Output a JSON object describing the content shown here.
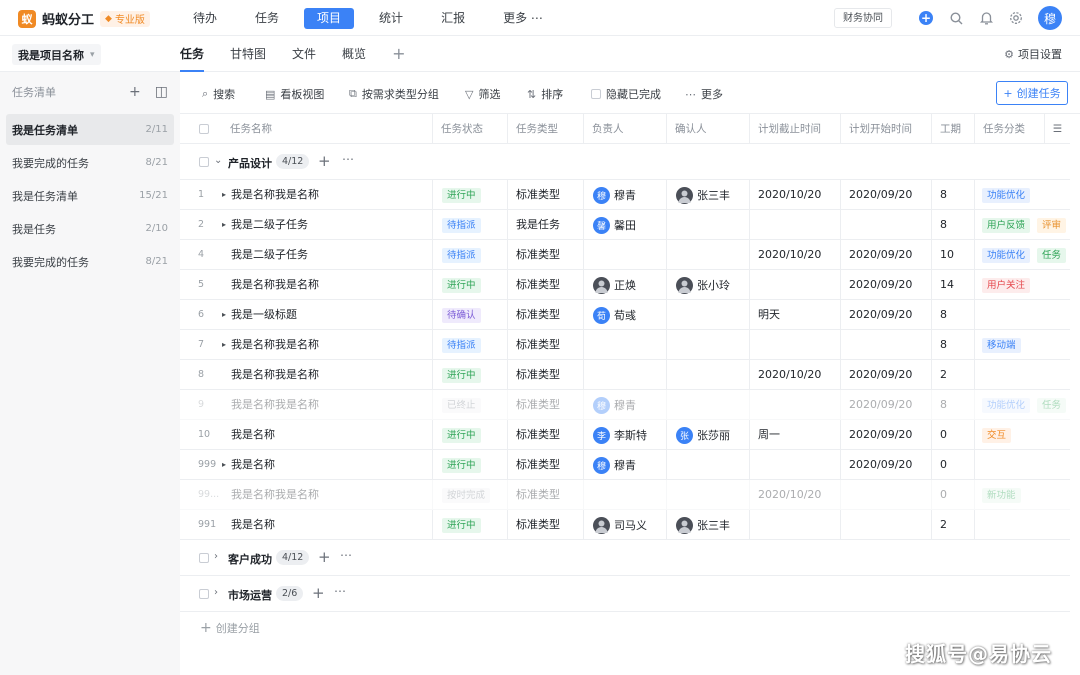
{
  "app": {
    "name": "蚂蚁分工",
    "logo_glyph": "蚁",
    "pro_badge": "专业版",
    "nav": [
      "待办",
      "任务",
      "项目",
      "统计",
      "汇报",
      "更多"
    ],
    "nav_more_glyph": "⋯",
    "active_nav": "项目",
    "finance_label": "财务协同",
    "user_avatar": "穆",
    "accent_color": "#3b82f6"
  },
  "project": {
    "name": "我是项目名称",
    "tabs": [
      "任务",
      "甘特图",
      "文件",
      "概览"
    ],
    "active_tab": "任务",
    "settings_label": "项目设置"
  },
  "sidebar": {
    "header": "任务清单",
    "items": [
      {
        "label": "我是任务清单",
        "count": "2/11"
      },
      {
        "label": "我要完成的任务",
        "count": "8/21"
      },
      {
        "label": "我是任务清单",
        "count": "15/21"
      },
      {
        "label": "我是任务",
        "count": "2/10"
      },
      {
        "label": "我要完成的任务",
        "count": "8/21"
      }
    ]
  },
  "toolbar": {
    "search": "搜索",
    "kanban": "看板视图",
    "group_by": "按需求类型分组",
    "filter": "筛选",
    "sort": "排序",
    "hide_done": "隐藏已完成",
    "more": "更多",
    "create": "创建任务"
  },
  "table": {
    "columns": [
      "任务名称",
      "任务状态",
      "任务类型",
      "负责人",
      "确认人",
      "计划截止时间",
      "计划开始时间",
      "工期",
      "任务分类"
    ],
    "groups": [
      {
        "name": "产品设计",
        "count": "4/12",
        "expanded": true
      },
      {
        "name": "客户成功",
        "count": "4/12",
        "expanded": false
      },
      {
        "name": "市场运营",
        "count": "2/6",
        "expanded": false
      }
    ],
    "rows": [
      {
        "num": "1",
        "caret": "▸",
        "name": "我是名称我是名称",
        "status": "进行中",
        "type": "标准类型",
        "owner": "穆青",
        "owner_av": "穆",
        "owner_photo": false,
        "confirmer": "张三丰",
        "confirmer_av": "",
        "confirmer_photo": true,
        "deadline": "2020/10/20",
        "start": "2020/09/20",
        "duration": "8",
        "tags": [
          "功能优化"
        ],
        "dim": false
      },
      {
        "num": "2",
        "caret": "▸",
        "name": "我是二级子任务",
        "status": "待指派",
        "type": "我是任务",
        "owner": "馨田",
        "owner_av": "馨",
        "owner_photo": false,
        "confirmer": "",
        "confirmer_av": "",
        "confirmer_photo": false,
        "deadline": "",
        "start": "",
        "duration": "8",
        "tags": [
          "用户反馈",
          "评审"
        ],
        "dim": false
      },
      {
        "num": "4",
        "caret": "",
        "name": "我是二级子任务",
        "status": "待指派",
        "type": "标准类型",
        "owner": "",
        "owner_av": "",
        "owner_photo": false,
        "confirmer": "",
        "confirmer_av": "",
        "confirmer_photo": false,
        "deadline": "2020/10/20",
        "start": "2020/09/20",
        "duration": "10",
        "tags": [
          "功能优化",
          "任务"
        ],
        "dim": false
      },
      {
        "num": "5",
        "caret": "",
        "name": "我是名称我是名称",
        "status": "进行中",
        "type": "标准类型",
        "owner": "正焕",
        "owner_av": "",
        "owner_photo": true,
        "confirmer": "张小玲",
        "confirmer_av": "",
        "confirmer_photo": true,
        "deadline": "",
        "start": "2020/09/20",
        "duration": "14",
        "tags": [
          "用户关注"
        ],
        "dim": false
      },
      {
        "num": "6",
        "caret": "▸",
        "name": "我是一级标题",
        "status": "待确认",
        "type": "标准类型",
        "owner": "荀彧",
        "owner_av": "荀",
        "owner_photo": false,
        "confirmer": "",
        "confirmer_av": "",
        "confirmer_photo": false,
        "deadline": "明天",
        "start": "2020/09/20",
        "duration": "8",
        "tags": [],
        "dim": false
      },
      {
        "num": "7",
        "caret": "▸",
        "name": "我是名称我是名称",
        "status": "待指派",
        "type": "标准类型",
        "owner": "",
        "owner_av": "",
        "owner_photo": false,
        "confirmer": "",
        "confirmer_av": "",
        "confirmer_photo": false,
        "deadline": "",
        "start": "",
        "duration": "8",
        "tags": [
          "移动端"
        ],
        "dim": false
      },
      {
        "num": "8",
        "caret": "",
        "name": "我是名称我是名称",
        "status": "进行中",
        "type": "标准类型",
        "owner": "",
        "owner_av": "",
        "owner_photo": false,
        "confirmer": "",
        "confirmer_av": "",
        "confirmer_photo": false,
        "deadline": "2020/10/20",
        "start": "2020/09/20",
        "duration": "2",
        "tags": [],
        "dim": false
      },
      {
        "num": "9",
        "caret": "",
        "name": "我是名称我是名称",
        "status": "已终止",
        "type": "标准类型",
        "owner": "穆青",
        "owner_av": "穆",
        "owner_photo": false,
        "confirmer": "",
        "confirmer_av": "",
        "confirmer_photo": false,
        "deadline": "",
        "start": "2020/09/20",
        "duration": "8",
        "tags": [
          "功能优化",
          "任务"
        ],
        "dim": true
      },
      {
        "num": "10",
        "caret": "",
        "name": "我是名称",
        "status": "进行中",
        "type": "标准类型",
        "owner": "李斯特",
        "owner_av": "李",
        "owner_photo": false,
        "confirmer": "张莎丽",
        "confirmer_av": "张",
        "confirmer_photo": false,
        "deadline": "周一",
        "start": "2020/09/20",
        "duration": "0",
        "tags": [
          "交互"
        ],
        "dim": false
      },
      {
        "num": "999",
        "caret": "▸",
        "name": "我是名称",
        "status": "进行中",
        "type": "标准类型",
        "owner": "穆青",
        "owner_av": "穆",
        "owner_photo": false,
        "confirmer": "",
        "confirmer_av": "",
        "confirmer_photo": false,
        "deadline": "",
        "start": "2020/09/20",
        "duration": "0",
        "tags": [],
        "dim": false
      },
      {
        "num": "99...",
        "caret": "",
        "name": "我是名称我是名称",
        "status": "按时完成",
        "type": "标准类型",
        "owner": "",
        "owner_av": "",
        "owner_photo": false,
        "confirmer": "",
        "confirmer_av": "",
        "confirmer_photo": false,
        "deadline": "2020/10/20",
        "start": "",
        "duration": "0",
        "tags": [
          "新功能"
        ],
        "dim": true
      },
      {
        "num": "991",
        "caret": "",
        "name": "我是名称",
        "status": "进行中",
        "type": "标准类型",
        "owner": "司马义",
        "owner_av": "",
        "owner_photo": true,
        "confirmer": "张三丰",
        "confirmer_av": "",
        "confirmer_photo": true,
        "deadline": "",
        "start": "",
        "duration": "2",
        "tags": [],
        "dim": false
      }
    ],
    "add_group": "创建分组"
  },
  "status_colors": {
    "进行中": {
      "bg": "#e6f7ec",
      "fg": "#2fa457"
    },
    "待指派": {
      "bg": "#e6f2ff",
      "fg": "#3b82f6"
    },
    "待确认": {
      "bg": "#efeafc",
      "fg": "#7b5bd6"
    },
    "已终止": {
      "bg": "#f2f3f5",
      "fg": "#8a9099"
    },
    "按时完成": {
      "bg": "#f2f3f5",
      "fg": "#8a9099"
    }
  },
  "tag_colors": {
    "功能优化": {
      "bg": "#e8f0fe",
      "fg": "#3b82f6"
    },
    "用户反馈": {
      "bg": "#e6f7ec",
      "fg": "#2fa457"
    },
    "评审": {
      "bg": "#fff4e5",
      "fg": "#e8912d"
    },
    "任务": {
      "bg": "#e6f7ec",
      "fg": "#2fa457"
    },
    "用户关注": {
      "bg": "#fdecec",
      "fg": "#e5484d"
    },
    "移动端": {
      "bg": "#e8f0fe",
      "fg": "#3b82f6"
    },
    "交互": {
      "bg": "#fff1e6",
      "fg": "#f08a24"
    },
    "新功能": {
      "bg": "#e6f7ec",
      "fg": "#2fa457"
    }
  },
  "watermark": "搜狐号@易协云"
}
